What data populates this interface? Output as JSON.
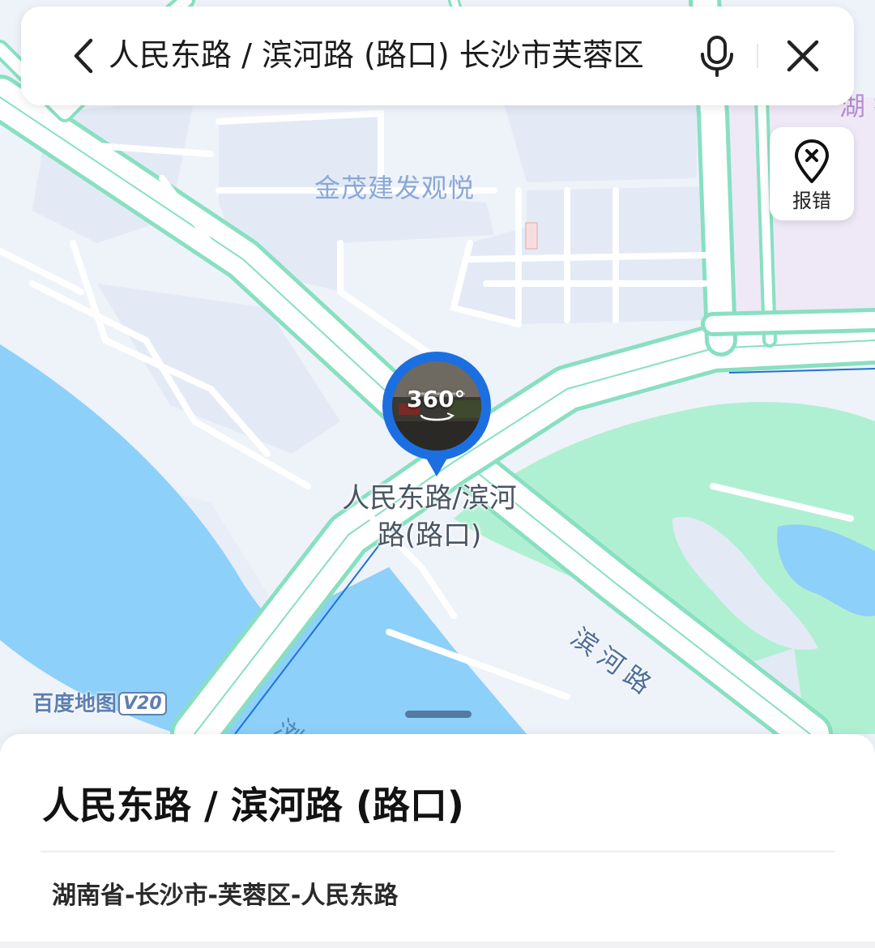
{
  "search_bar": {
    "query": "人民东路 / 滨河路 (路口) 长沙市芙蓉区",
    "back_icon": "chevron-left-icon",
    "mic_icon": "microphone-icon",
    "close_icon": "close-icon"
  },
  "report_error": {
    "label": "报错",
    "icon": "location-pin-x-icon"
  },
  "map": {
    "district_label": "金茂建发观悦",
    "poi_label_line1": "人民东路/滨河",
    "poi_label_line2": "路(路口)",
    "road_label": "滨河路",
    "river_label": "浏阳河",
    "edge_label": "湖 批",
    "logo_text": "百度地图",
    "logo_version": "V20",
    "panorama_badge": "360°",
    "colors": {
      "water": "#8dd0fa",
      "park": "#b0f0d2",
      "road_outline": "#88e0c0",
      "block": "#e4ebf6",
      "land": "#eef2f9",
      "marker": "#1c6fe0"
    }
  },
  "place": {
    "title": "人民东路 / 滨河路 (路口)",
    "address": "湖南省-长沙市-芙蓉区-人民东路"
  }
}
